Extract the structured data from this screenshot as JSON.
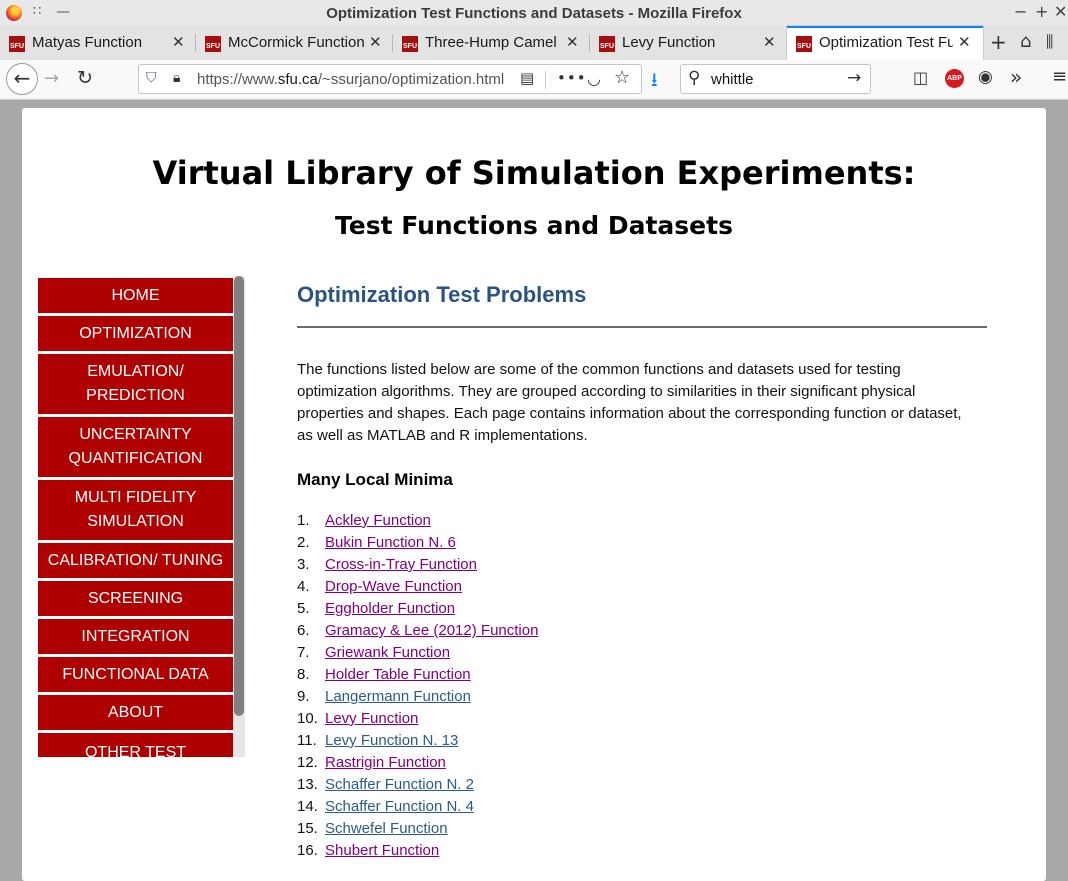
{
  "window": {
    "title": "Optimization Test Functions and Datasets - Mozilla Firefox"
  },
  "tabs": [
    {
      "label": "Matyas Function",
      "favicon": "SFU"
    },
    {
      "label": "McCormick Function",
      "favicon": "SFU"
    },
    {
      "label": "Three-Hump Camel",
      "favicon": "SFU"
    },
    {
      "label": "Levy Function",
      "favicon": "SFU"
    },
    {
      "label": "Optimization Test Fu",
      "favicon": "SFU",
      "active": true
    }
  ],
  "navbar": {
    "url_prefix": "https://www.",
    "url_domain": "sfu.ca",
    "url_path": "/~ssurjano/optimization.html",
    "search_value": "whittle",
    "adblock_label": "ABP"
  },
  "page": {
    "title": "Virtual Library of Simulation Experiments:",
    "subtitle": "Test Functions and Datasets",
    "menu": [
      "HOME",
      "OPTIMIZATION",
      "EMULATION/\nPREDICTION",
      "UNCERTAINTY\nQUANTIFICATION",
      "MULTI FIDELITY\nSIMULATION",
      "CALIBRATION/ TUNING",
      "SCREENING",
      "INTEGRATION",
      "FUNCTIONAL DATA",
      "ABOUT",
      "OTHER TEST"
    ],
    "section_title": "Optimization Test Problems",
    "intro": "The functions listed below are some of the common functions and datasets used for testing optimization algorithms. They are grouped according to similarities in their significant physical properties and shapes. Each page contains information about the corresponding function or dataset, as well as MATLAB and R implementations.",
    "subsection": "Many Local Minima",
    "functions": [
      {
        "num": "1.",
        "name": "Ackley Function",
        "visited": true
      },
      {
        "num": "2.",
        "name": "Bukin Function N. 6",
        "visited": true
      },
      {
        "num": "3.",
        "name": "Cross-in-Tray Function",
        "visited": true
      },
      {
        "num": "4.",
        "name": "Drop-Wave Function",
        "visited": true
      },
      {
        "num": "5.",
        "name": "Eggholder Function",
        "visited": true
      },
      {
        "num": "6.",
        "name": "Gramacy & Lee (2012) Function",
        "visited": true
      },
      {
        "num": "7.",
        "name": "Griewank Function",
        "visited": true
      },
      {
        "num": "8.",
        "name": "Holder Table Function",
        "visited": true
      },
      {
        "num": "9.",
        "name": "Langermann Function",
        "visited": false
      },
      {
        "num": "10.",
        "name": "Levy Function",
        "visited": true
      },
      {
        "num": "11.",
        "name": "Levy Function N. 13",
        "visited": false
      },
      {
        "num": "12.",
        "name": "Rastrigin Function",
        "visited": true
      },
      {
        "num": "13.",
        "name": "Schaffer Function N. 2",
        "visited": false
      },
      {
        "num": "14.",
        "name": "Schaffer Function N. 4",
        "visited": false
      },
      {
        "num": "15.",
        "name": "Schwefel Function",
        "visited": false
      },
      {
        "num": "16.",
        "name": "Shubert Function",
        "visited": true
      }
    ]
  },
  "colors": {
    "menu_bg": "#ae0000",
    "section_title": "#2a5381",
    "link_visited": "#800080",
    "link_unvisited": "#2b5b8a",
    "active_tab_accent": "#0a84ff"
  }
}
